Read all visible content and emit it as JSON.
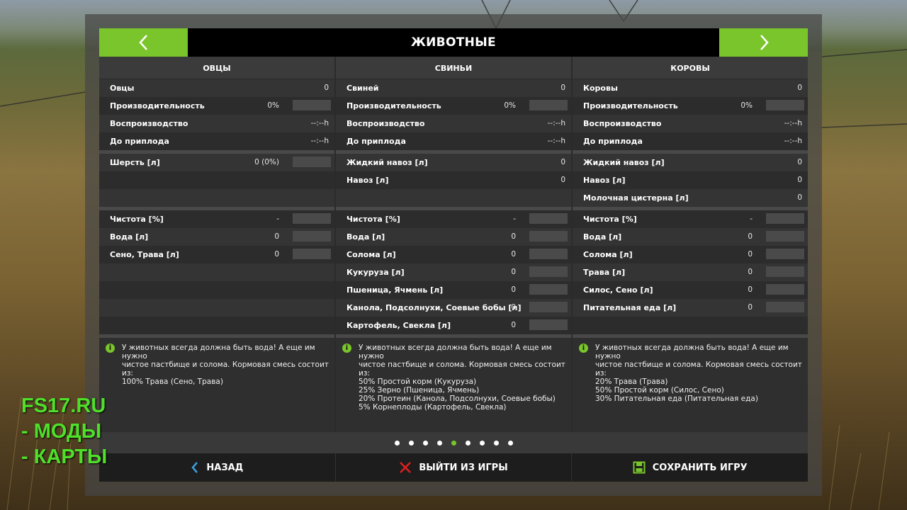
{
  "header": {
    "title": "ЖИВОТНЫЕ"
  },
  "columns": [
    {
      "name": "ОВЦЫ",
      "stats": [
        {
          "label": "Овцы",
          "value": "0",
          "bar": false
        },
        {
          "label": "Производительность",
          "value": "0%",
          "bar": true
        },
        {
          "label": "Воспроизводство",
          "value": "--:--h",
          "bar": false
        },
        {
          "label": "До приплода",
          "value": "--:--h",
          "bar": false
        }
      ],
      "products": [
        {
          "label": "Шерсть [л]",
          "value": "0 (0%)",
          "bar": true
        },
        {
          "label": "",
          "value": "",
          "bar": false
        },
        {
          "label": "",
          "value": "",
          "bar": false
        }
      ],
      "needs": [
        {
          "label": "Чистота [%]",
          "value": "-",
          "bar": true
        },
        {
          "label": "Вода [л]",
          "value": "0",
          "bar": true
        },
        {
          "label": "Сено, Трава [л]",
          "value": "0",
          "bar": true
        },
        {
          "label": "",
          "value": "",
          "bar": false
        },
        {
          "label": "",
          "value": "",
          "bar": false
        },
        {
          "label": "",
          "value": "",
          "bar": false
        },
        {
          "label": "",
          "value": "",
          "bar": false
        }
      ],
      "info": [
        "У животных всегда должна быть вода! А еще им нужно",
        "чистое пастбище и солома. Кормовая смесь состоит",
        "из:",
        "100% Трава (Сено, Трава)",
        "",
        ""
      ]
    },
    {
      "name": "СВИНЬИ",
      "stats": [
        {
          "label": "Свиней",
          "value": "0",
          "bar": false
        },
        {
          "label": "Производительность",
          "value": "0%",
          "bar": true
        },
        {
          "label": "Воспроизводство",
          "value": "--:--h",
          "bar": false
        },
        {
          "label": "До приплода",
          "value": "--:--h",
          "bar": false
        }
      ],
      "products": [
        {
          "label": "Жидкий навоз [л]",
          "value": "0",
          "bar": false
        },
        {
          "label": "Навоз [л]",
          "value": "0",
          "bar": false
        },
        {
          "label": "",
          "value": "",
          "bar": false
        }
      ],
      "needs": [
        {
          "label": "Чистота [%]",
          "value": "-",
          "bar": true
        },
        {
          "label": "Вода [л]",
          "value": "0",
          "bar": true
        },
        {
          "label": "Солома [л]",
          "value": "0",
          "bar": true
        },
        {
          "label": "Кукуруза [л]",
          "value": "0",
          "bar": true
        },
        {
          "label": "Пшеница, Ячмень [л]",
          "value": "0",
          "bar": true
        },
        {
          "label": "Канола, Подсолнухи, Соевые бобы [л]",
          "value": "0",
          "bar": true
        },
        {
          "label": "Картофель, Свекла [л]",
          "value": "0",
          "bar": true
        }
      ],
      "info": [
        "У животных всегда должна быть вода! А еще им нужно",
        "чистое пастбище и солома. Кормовая смесь состоит",
        "из:",
        "50% Простой корм (Кукуруза)",
        "25% Зерно (Пшеница, Ячмень)",
        "20% Протеин (Канола, Подсолнухи, Соевые бобы)",
        "5% Корнеплоды (Картофель, Свекла)"
      ]
    },
    {
      "name": "КОРОВЫ",
      "stats": [
        {
          "label": "Коровы",
          "value": "0",
          "bar": false
        },
        {
          "label": "Производительность",
          "value": "0%",
          "bar": true
        },
        {
          "label": "Воспроизводство",
          "value": "--:--h",
          "bar": false
        },
        {
          "label": "До приплода",
          "value": "--:--h",
          "bar": false
        }
      ],
      "products": [
        {
          "label": "Жидкий навоз [л]",
          "value": "0",
          "bar": false
        },
        {
          "label": "Навоз [л]",
          "value": "0",
          "bar": false
        },
        {
          "label": "Молочная цистерна [л]",
          "value": "0",
          "bar": false
        }
      ],
      "needs": [
        {
          "label": "Чистота [%]",
          "value": "-",
          "bar": true
        },
        {
          "label": "Вода [л]",
          "value": "0",
          "bar": true
        },
        {
          "label": "Солома [л]",
          "value": "0",
          "bar": true
        },
        {
          "label": "Трава [л]",
          "value": "0",
          "bar": true
        },
        {
          "label": "Силос, Сено [л]",
          "value": "0",
          "bar": true
        },
        {
          "label": "Питательная еда [л]",
          "value": "0",
          "bar": true
        },
        {
          "label": "",
          "value": "",
          "bar": false
        }
      ],
      "info": [
        "У животных всегда должна быть вода! А еще им нужно",
        "чистое пастбище и солома. Кормовая смесь состоит",
        "из:",
        "20% Трава (Трава)",
        "50% Простой корм (Силос, Сено)",
        "30% Питательная еда (Питательная еда)",
        ""
      ]
    }
  ],
  "pagination": {
    "count": 9,
    "active": 4
  },
  "footer": {
    "back": "НАЗАД",
    "quit": "ВЫЙТИ ИЗ ИГРЫ",
    "save": "СОХРАНИТЬ ИГРУ"
  },
  "watermark": [
    "FS17.RU",
    "- МОДЫ",
    "- КАРТЫ"
  ],
  "colors": {
    "accent": "#7ac52b",
    "quit_icon": "#e02020",
    "back_icon": "#3aa0e0",
    "watermark": "#4fe02a"
  },
  "icons": {
    "prev": "chevron-left-icon",
    "next": "chevron-right-icon",
    "info": "info-icon",
    "back": "chevron-left-icon",
    "quit": "close-x-icon",
    "save": "floppy-disk-icon"
  }
}
